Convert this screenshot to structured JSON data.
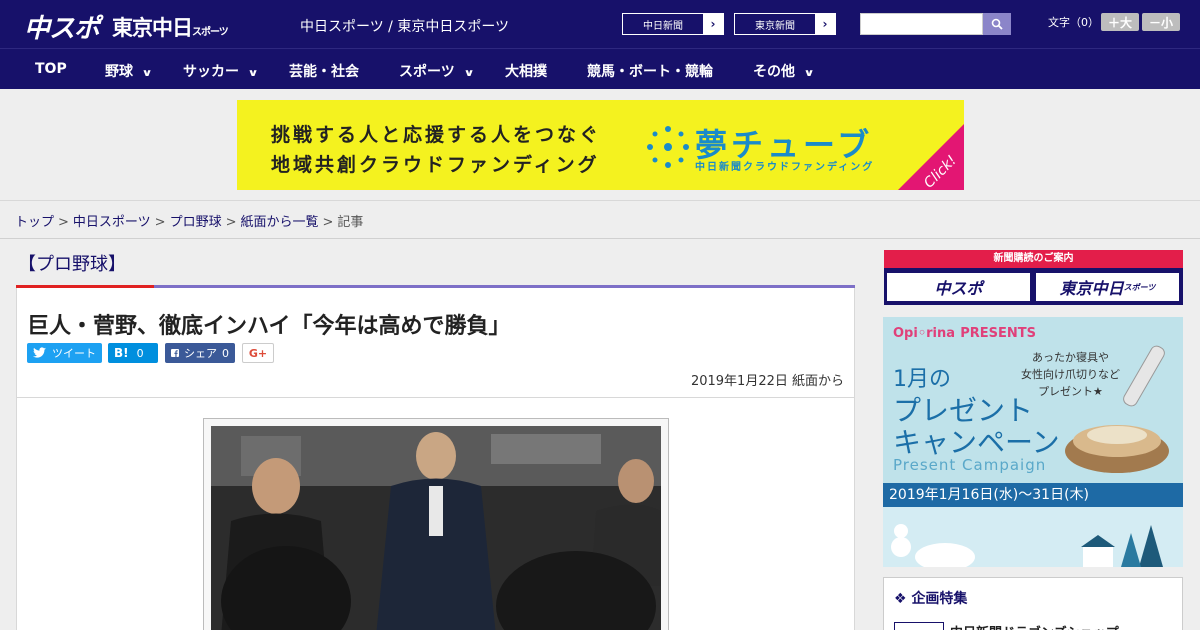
{
  "header": {
    "logo_main": "中スポ",
    "logo_tokyo": "東京中日",
    "logo_tokyo_sub": "スポーツ",
    "site_title": "中日スポーツ / 東京中日スポーツ",
    "ext_links": [
      {
        "label": "中日新聞",
        "arrow": "›"
      },
      {
        "label": "東京新聞",
        "arrow": "›"
      }
    ],
    "search_placeholder": "",
    "font_size_label": "文字（0）",
    "font_bigger": "＋大",
    "font_smaller": "－小"
  },
  "nav": {
    "items": [
      {
        "label": "TOP"
      },
      {
        "label": "野球",
        "chevron": "∨"
      },
      {
        "label": "サッカー",
        "chevron": "∨"
      },
      {
        "label": "芸能・社会"
      },
      {
        "label": "スポーツ",
        "chevron": "∨"
      },
      {
        "label": "大相撲"
      },
      {
        "label": "競馬・ボート・競輪"
      },
      {
        "label": "その他",
        "chevron": "∨"
      }
    ]
  },
  "banner": {
    "line1": "挑戦する人と応援する人をつなぐ",
    "line2": "地域共創クラウドファンディング",
    "brand": "夢チューブ",
    "brand_sub": "中日新聞クラウドファンディング",
    "click": "Click!"
  },
  "breadcrumb": {
    "items": [
      "トップ",
      "中日スポーツ",
      "プロ野球",
      "紙面から一覧"
    ],
    "separator": ">",
    "current": "記事"
  },
  "article": {
    "category": "【プロ野球】",
    "headline": "巨人・菅野、徹底インハイ「今年は高めで勝負」",
    "share": {
      "tweet": "ツイート",
      "hatena": "B!",
      "hatena_count": "0",
      "facebook": "シェア",
      "facebook_count": "0",
      "gplus": "G+"
    },
    "date": "2019年1月22日 紙面から"
  },
  "sidebar": {
    "subscribe_title": "新聞購読のご案内",
    "subscribe_chuspo": "中スポ",
    "subscribe_tokyo": "東京中日",
    "subscribe_tokyo_sub": "スポーツ",
    "ad": {
      "brand": "Opi◦rina",
      "presents": "PRESENTS",
      "copy_lines": [
        "あったか寝具や",
        "女性向け爪切りなど",
        "プレゼント★"
      ],
      "month": "1月の",
      "big_line1": "プレゼント",
      "big_line2": "キャンペーン",
      "english": "Present Campaign",
      "dates": "2019年1月16日(水)〜31日(木)"
    },
    "feature_heading": "企画特集",
    "feature_item": "中日新聞ドラゴンズショップ"
  },
  "colors": {
    "header_bg": "#17116a",
    "accent_red": "#e02121",
    "accent_purple": "#7d6fc7",
    "banner_yellow": "#f4f21f"
  }
}
